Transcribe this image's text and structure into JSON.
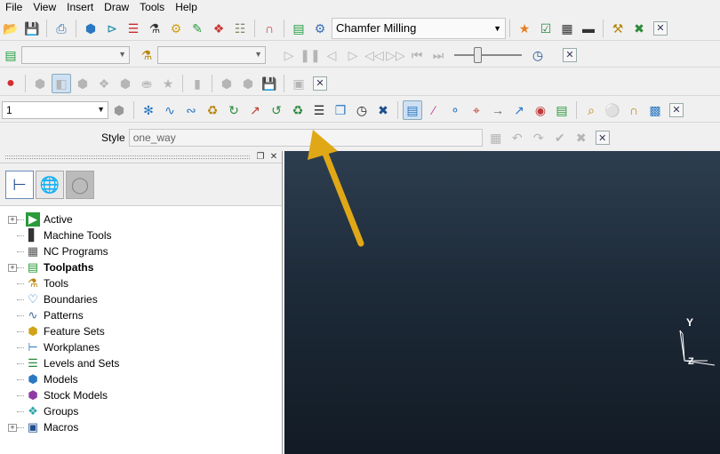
{
  "menu": [
    "File",
    "View",
    "Insert",
    "Draw",
    "Tools",
    "Help"
  ],
  "toolbar1": {
    "strategy_label": "Chamfer Milling"
  },
  "toolbar3": {
    "tool_number": "1"
  },
  "style_row": {
    "label": "Style",
    "value": "one_way"
  },
  "tree": [
    {
      "label": "Active",
      "icon": "active-icon",
      "expandable": true,
      "bold": false
    },
    {
      "label": "Machine Tools",
      "icon": "machine-tool-icon",
      "expandable": false,
      "bold": false
    },
    {
      "label": "NC Programs",
      "icon": "nc-program-icon",
      "expandable": false,
      "bold": false
    },
    {
      "label": "Toolpaths",
      "icon": "toolpath-icon",
      "expandable": true,
      "bold": true
    },
    {
      "label": "Tools",
      "icon": "tool-icon",
      "expandable": false,
      "bold": false
    },
    {
      "label": "Boundaries",
      "icon": "boundary-icon",
      "expandable": false,
      "bold": false
    },
    {
      "label": "Patterns",
      "icon": "pattern-icon",
      "expandable": false,
      "bold": false
    },
    {
      "label": "Feature Sets",
      "icon": "feature-set-icon",
      "expandable": false,
      "bold": false
    },
    {
      "label": "Workplanes",
      "icon": "workplane-icon",
      "expandable": false,
      "bold": false
    },
    {
      "label": "Levels and Sets",
      "icon": "level-icon",
      "expandable": false,
      "bold": false
    },
    {
      "label": "Models",
      "icon": "model-icon",
      "expandable": false,
      "bold": false
    },
    {
      "label": "Stock Models",
      "icon": "stock-model-icon",
      "expandable": false,
      "bold": false
    },
    {
      "label": "Groups",
      "icon": "group-icon",
      "expandable": false,
      "bold": false
    },
    {
      "label": "Macros",
      "icon": "macro-icon",
      "expandable": true,
      "bold": false
    }
  ],
  "viewport": {
    "axis_label": "Y"
  },
  "colors": {
    "annotation_arrow": "#e0a817",
    "viewport_top": "#2d3e50",
    "viewport_bottom": "#121b25"
  }
}
